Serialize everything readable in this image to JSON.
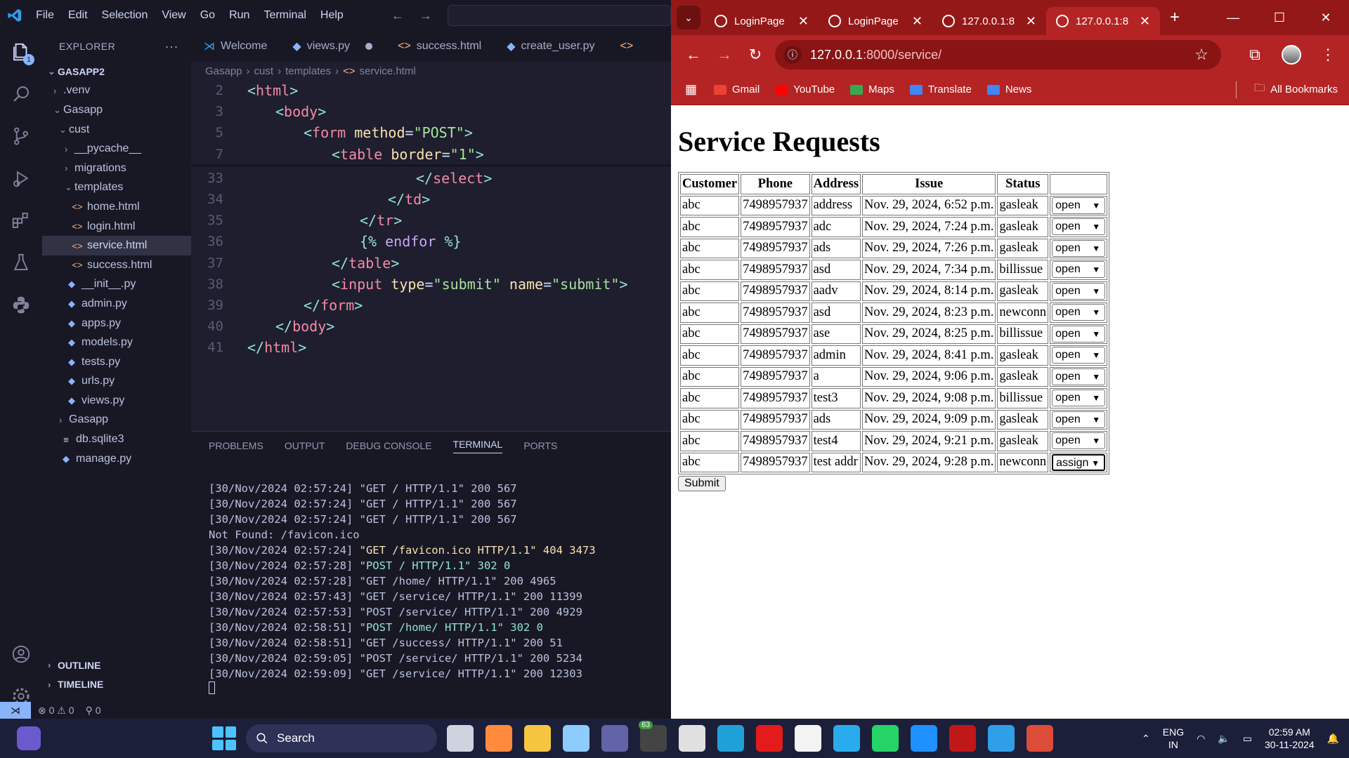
{
  "vscode": {
    "menu": [
      "File",
      "Edit",
      "Selection",
      "View",
      "Go",
      "Run",
      "Terminal",
      "Help"
    ],
    "explorer_title": "EXPLORER",
    "accounts_badge": "1",
    "tree": [
      {
        "label": "GASAPP2",
        "indent": 0,
        "chev": "⌄",
        "type": "root"
      },
      {
        "label": ".venv",
        "indent": 1,
        "chev": "›",
        "type": "folder"
      },
      {
        "label": "Gasapp",
        "indent": 1,
        "chev": "⌄",
        "type": "folder"
      },
      {
        "label": "cust",
        "indent": 2,
        "chev": "⌄",
        "type": "folder"
      },
      {
        "label": "__pycache__",
        "indent": 3,
        "chev": "›",
        "type": "folder"
      },
      {
        "label": "migrations",
        "indent": 3,
        "chev": "›",
        "type": "folder"
      },
      {
        "label": "templates",
        "indent": 3,
        "chev": "⌄",
        "type": "folder"
      },
      {
        "label": "home.html",
        "indent": 4,
        "type": "html"
      },
      {
        "label": "login.html",
        "indent": 4,
        "type": "html"
      },
      {
        "label": "service.html",
        "indent": 4,
        "type": "html",
        "selected": true
      },
      {
        "label": "success.html",
        "indent": 4,
        "type": "html"
      },
      {
        "label": "__init__.py",
        "indent": 3,
        "type": "py"
      },
      {
        "label": "admin.py",
        "indent": 3,
        "type": "py"
      },
      {
        "label": "apps.py",
        "indent": 3,
        "type": "py"
      },
      {
        "label": "models.py",
        "indent": 3,
        "type": "py"
      },
      {
        "label": "tests.py",
        "indent": 3,
        "type": "py"
      },
      {
        "label": "urls.py",
        "indent": 3,
        "type": "py"
      },
      {
        "label": "views.py",
        "indent": 3,
        "type": "py"
      },
      {
        "label": "Gasapp",
        "indent": 2,
        "chev": "›",
        "type": "folder"
      },
      {
        "label": "db.sqlite3",
        "indent": 2,
        "type": "db"
      },
      {
        "label": "manage.py",
        "indent": 2,
        "type": "py"
      }
    ],
    "outline_label": "OUTLINE",
    "timeline_label": "TIMELINE",
    "tabs": [
      {
        "label": "Welcome",
        "icon": "vscode-icon"
      },
      {
        "label": "views.py",
        "icon": "python-icon",
        "dirty": true
      },
      {
        "label": "success.html",
        "icon": "html-icon"
      },
      {
        "label": "create_user.py",
        "icon": "python-icon"
      },
      {
        "label": "",
        "icon": "html-icon"
      }
    ],
    "breadcrumb": [
      "Gasapp",
      "›",
      "cust",
      "›",
      "templates",
      "›",
      "<>",
      "service.html"
    ],
    "sticky_lines": [
      {
        "n": "2",
        "html": "<span class='br'>&lt;</span><span class='tag'>html</span><span class='br'>&gt;</span>",
        "ind": 0
      },
      {
        "n": "3",
        "html": "<span class='br'>&lt;</span><span class='tag'>body</span><span class='br'>&gt;</span>",
        "ind": 1
      },
      {
        "n": "5",
        "html": "<span class='br'>&lt;</span><span class='tag'>form</span> <span class='attr'>method</span><span class='pun'>=</span><span class='str'>\"POST\"</span><span class='br'>&gt;</span>",
        "ind": 2
      },
      {
        "n": "7",
        "html": "<span class='br'>&lt;</span><span class='tag'>table</span> <span class='attr'>border</span><span class='pun'>=</span><span class='str'>\"1\"</span><span class='br'>&gt;</span>",
        "ind": 3
      }
    ],
    "code_lines": [
      {
        "n": "33",
        "html": "<span class='br'>&lt;/</span><span class='tag'>select</span><span class='br'>&gt;</span>",
        "ind": 6
      },
      {
        "n": "34",
        "html": "<span class='br'>&lt;/</span><span class='tag'>td</span><span class='br'>&gt;</span>",
        "ind": 5
      },
      {
        "n": "35",
        "html": "<span class='br'>&lt;/</span><span class='tag'>tr</span><span class='br'>&gt;</span>",
        "ind": 4
      },
      {
        "n": "36",
        "html": "<span class='br'>{%</span> <span class='tmpl'>endfor</span> <span class='br'>%}</span>",
        "ind": 4
      },
      {
        "n": "37",
        "html": "<span class='br'>&lt;/</span><span class='tag'>table</span><span class='br'>&gt;</span>",
        "ind": 3
      },
      {
        "n": "38",
        "html": "<span class='br'>&lt;</span><span class='tag'>input</span> <span class='attr'>type</span><span class='pun'>=</span><span class='str'>\"submit\"</span> <span class='attr'>name</span><span class='pun'>=</span><span class='str'>\"submit\"</span><span class='br'>&gt;</span>",
        "ind": 3
      },
      {
        "n": "39",
        "html": "<span class='br'>&lt;/</span><span class='tag'>form</span><span class='br'>&gt;</span>",
        "ind": 2
      },
      {
        "n": "40",
        "html": "<span class='br'>&lt;/</span><span class='tag'>body</span><span class='br'>&gt;</span>",
        "ind": 1
      },
      {
        "n": "41",
        "html": "<span class='br'>&lt;/</span><span class='tag'>html</span><span class='br'>&gt;</span>",
        "ind": 0
      }
    ],
    "panel_tabs": [
      "PROBLEMS",
      "OUTPUT",
      "DEBUG CONSOLE",
      "TERMINAL",
      "PORTS"
    ],
    "active_panel_tab": 3,
    "terminal_lines": [
      {
        "ts": "[30/Nov/2024 02:57:24]",
        "req": "\"GET / HTTP/1.1\"",
        "rest": " 200 567",
        "cls": ""
      },
      {
        "ts": "[30/Nov/2024 02:57:24]",
        "req": "\"GET / HTTP/1.1\"",
        "rest": " 200 567",
        "cls": ""
      },
      {
        "ts": "[30/Nov/2024 02:57:24]",
        "req": "\"GET / HTTP/1.1\"",
        "rest": " 200 567",
        "cls": ""
      },
      {
        "ts": "Not Found: /favicon.ico",
        "req": "",
        "rest": "",
        "cls": ""
      },
      {
        "ts": "[30/Nov/2024 02:57:24]",
        "req": "\"GET /favicon.ico HTTP/1.1\"",
        "rest": " 404 3473",
        "cls": "y"
      },
      {
        "ts": "[30/Nov/2024 02:57:28]",
        "req": "\"POST / HTTP/1.1\"",
        "rest": " 302 0",
        "cls": "c"
      },
      {
        "ts": "[30/Nov/2024 02:57:28]",
        "req": "\"GET /home/ HTTP/1.1\"",
        "rest": " 200 4965",
        "cls": ""
      },
      {
        "ts": "[30/Nov/2024 02:57:43]",
        "req": "\"GET /service/ HTTP/1.1\"",
        "rest": " 200 11399",
        "cls": ""
      },
      {
        "ts": "[30/Nov/2024 02:57:53]",
        "req": "\"POST /service/ HTTP/1.1\"",
        "rest": " 200 4929",
        "cls": ""
      },
      {
        "ts": "[30/Nov/2024 02:58:51]",
        "req": "\"POST /home/ HTTP/1.1\"",
        "rest": " 302 0",
        "cls": "c"
      },
      {
        "ts": "[30/Nov/2024 02:58:51]",
        "req": "\"GET /success/ HTTP/1.1\"",
        "rest": " 200 51",
        "cls": ""
      },
      {
        "ts": "[30/Nov/2024 02:59:05]",
        "req": "\"POST /service/ HTTP/1.1\"",
        "rest": " 200 5234",
        "cls": ""
      },
      {
        "ts": "[30/Nov/2024 02:59:09]",
        "req": "\"GET /service/ HTTP/1.1\"",
        "rest": " 200 12303",
        "cls": ""
      }
    ],
    "status": {
      "errors": "0",
      "warnings": "0",
      "ports": "0"
    }
  },
  "chrome": {
    "tabs": [
      {
        "title": "LoginPage",
        "active": false
      },
      {
        "title": "LoginPage",
        "active": false
      },
      {
        "title": "127.0.0.1:8",
        "active": false
      },
      {
        "title": "127.0.0.1:8",
        "active": true
      }
    ],
    "url_host": "127.0.0.1",
    "url_rest": ":8000/service/",
    "bookmarks": [
      {
        "label": "Gmail",
        "color": "#ea4335"
      },
      {
        "label": "YouTube",
        "color": "#ff0000"
      },
      {
        "label": "Maps",
        "color": "#34a853"
      },
      {
        "label": "Translate",
        "color": "#4285f4"
      },
      {
        "label": "News",
        "color": "#4285f4"
      }
    ],
    "all_bookmarks": "All Bookmarks"
  },
  "page": {
    "heading": "Service Requests",
    "columns": [
      "Customer",
      "Phone",
      "Address",
      "Issue",
      "Status",
      ""
    ],
    "rows": [
      [
        "abc",
        "7498957937",
        "address",
        "Nov. 29, 2024, 6:52 p.m.",
        "gasleak",
        "open"
      ],
      [
        "abc",
        "7498957937",
        "adc",
        "Nov. 29, 2024, 7:24 p.m.",
        "gasleak",
        "open"
      ],
      [
        "abc",
        "7498957937",
        "ads",
        "Nov. 29, 2024, 7:26 p.m.",
        "gasleak",
        "open"
      ],
      [
        "abc",
        "7498957937",
        "asd",
        "Nov. 29, 2024, 7:34 p.m.",
        "billissue",
        "open"
      ],
      [
        "abc",
        "7498957937",
        "aadv",
        "Nov. 29, 2024, 8:14 p.m.",
        "gasleak",
        "open"
      ],
      [
        "abc",
        "7498957937",
        "asd",
        "Nov. 29, 2024, 8:23 p.m.",
        "newconn",
        "open"
      ],
      [
        "abc",
        "7498957937",
        "ase",
        "Nov. 29, 2024, 8:25 p.m.",
        "billissue",
        "open"
      ],
      [
        "abc",
        "7498957937",
        "admin",
        "Nov. 29, 2024, 8:41 p.m.",
        "gasleak",
        "open"
      ],
      [
        "abc",
        "7498957937",
        "a",
        "Nov. 29, 2024, 9:06 p.m.",
        "gasleak",
        "open"
      ],
      [
        "abc",
        "7498957937",
        "test3",
        "Nov. 29, 2024, 9:08 p.m.",
        "billissue",
        "open"
      ],
      [
        "abc",
        "7498957937",
        "ads",
        "Nov. 29, 2024, 9:09 p.m.",
        "gasleak",
        "open"
      ],
      [
        "abc",
        "7498957937",
        "test4",
        "Nov. 29, 2024, 9:21 p.m.",
        "gasleak",
        "open"
      ],
      [
        "abc",
        "7498957937",
        "test addr",
        "Nov. 29, 2024, 9:28 p.m.",
        "newconn",
        "assign"
      ]
    ],
    "submit_label": "Submit"
  },
  "taskbar": {
    "search_label": "Search",
    "lang_line1": "ENG",
    "lang_line2": "IN",
    "time": "02:59 AM",
    "date": "30-11-2024",
    "badge": "63",
    "apps": [
      {
        "name": "task-view-icon",
        "color": "#cfd3e0"
      },
      {
        "name": "copilot-icon",
        "color": "#ff8a3d"
      },
      {
        "name": "file-explorer-icon",
        "color": "#f5c542"
      },
      {
        "name": "notepad-icon",
        "color": "#8ecbff"
      },
      {
        "name": "teams-icon",
        "color": "#6264a7"
      },
      {
        "name": "app-badge-icon",
        "color": "#444"
      },
      {
        "name": "clock-app-icon",
        "color": "#e0e0e0"
      },
      {
        "name": "edge-icon",
        "color": "#1fa0d8"
      },
      {
        "name": "opera-icon",
        "color": "#e41b1b"
      },
      {
        "name": "store-icon",
        "color": "#f3f3f3"
      },
      {
        "name": "telegram-icon",
        "color": "#2aabee"
      },
      {
        "name": "whatsapp-icon",
        "color": "#25d366"
      },
      {
        "name": "myhp-icon",
        "color": "#1e90ff"
      },
      {
        "name": "mcafee-icon",
        "color": "#c01818"
      },
      {
        "name": "vscode-taskbar-icon",
        "color": "#2f9fe8"
      },
      {
        "name": "chrome-taskbar-icon",
        "color": "#dd4b39"
      }
    ]
  }
}
